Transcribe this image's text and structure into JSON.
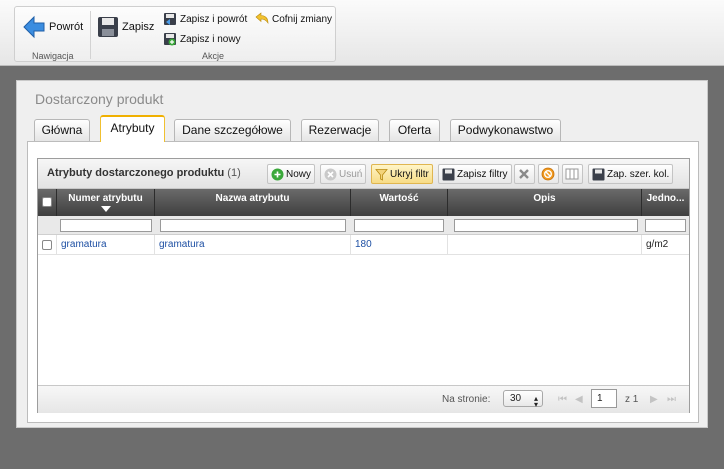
{
  "ribbon": {
    "back_label": "Powrót",
    "save_label": "Zapisz",
    "save_return_label": "Zapisz i powrót",
    "save_new_label": "Zapisz i nowy",
    "undo_label": "Cofnij zmiany",
    "group_navigation": "Nawigacja",
    "group_actions": "Akcje"
  },
  "dialog": {
    "title": "Dostarczony produkt",
    "tabs": [
      {
        "label": "Główna"
      },
      {
        "label": "Atrybuty",
        "active": true
      },
      {
        "label": "Dane szczegółowe"
      },
      {
        "label": "Rezerwacje"
      },
      {
        "label": "Oferta"
      },
      {
        "label": "Podwykonawstwo"
      }
    ]
  },
  "grid": {
    "title": "Atrybuty dostarczonego produktu",
    "count": "(1)",
    "toolbar": {
      "new_label": "Nowy",
      "delete_label": "Usuń",
      "hide_filter_label": "Ukryj filtr",
      "save_filters_label": "Zapisz filtry",
      "save_col_width_label": "Zap. szer. kol."
    },
    "columns": [
      "Numer atrybutu",
      "Nazwa atrybutu",
      "Wartość",
      "Opis",
      "Jedno..."
    ],
    "rows": [
      {
        "number": "gramatura",
        "name": "gramatura",
        "value": "180",
        "description": "",
        "unit": "g/m2"
      }
    ],
    "pager": {
      "per_page_label": "Na stronie:",
      "per_page_value": "30",
      "page_value": "1",
      "of_label": "z 1"
    }
  },
  "colors": {
    "accent_tab": "#f0b000",
    "link": "#1d4fa3",
    "header_bg": "#4f4f4f"
  }
}
